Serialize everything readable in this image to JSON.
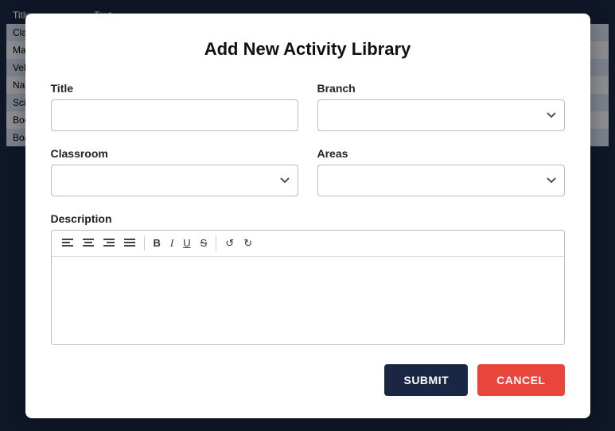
{
  "modal": {
    "title": "Add New Activity Library",
    "fields": {
      "title_label": "Title",
      "title_placeholder": "",
      "branch_label": "Branch",
      "branch_placeholder": "",
      "classroom_label": "Classroom",
      "classroom_placeholder": "",
      "areas_label": "Areas",
      "areas_placeholder": "",
      "description_label": "Description"
    },
    "toolbar": {
      "align_left": "≡",
      "align_center": "≡",
      "align_right": "≡",
      "align_justify": "≡",
      "bold": "B",
      "italic": "I",
      "underline": "U",
      "strikethrough": "S",
      "undo": "↺",
      "redo": "↻"
    },
    "buttons": {
      "submit": "SUBMIT",
      "cancel": "CANCEL"
    }
  },
  "background": {
    "header": [
      "Title",
      "Text"
    ],
    "rows": [
      {
        "col1": "Cla...",
        "col2": ""
      },
      {
        "col1": "Ma...",
        "col2": ""
      },
      {
        "col1": "Veh...",
        "col2": ""
      },
      {
        "col1": "Nat...",
        "col2": ""
      },
      {
        "col1": "Sci...",
        "col2": ""
      },
      {
        "col1": "Boo...",
        "col2": ""
      },
      {
        "col1": "Boa...",
        "col2": ""
      }
    ]
  }
}
